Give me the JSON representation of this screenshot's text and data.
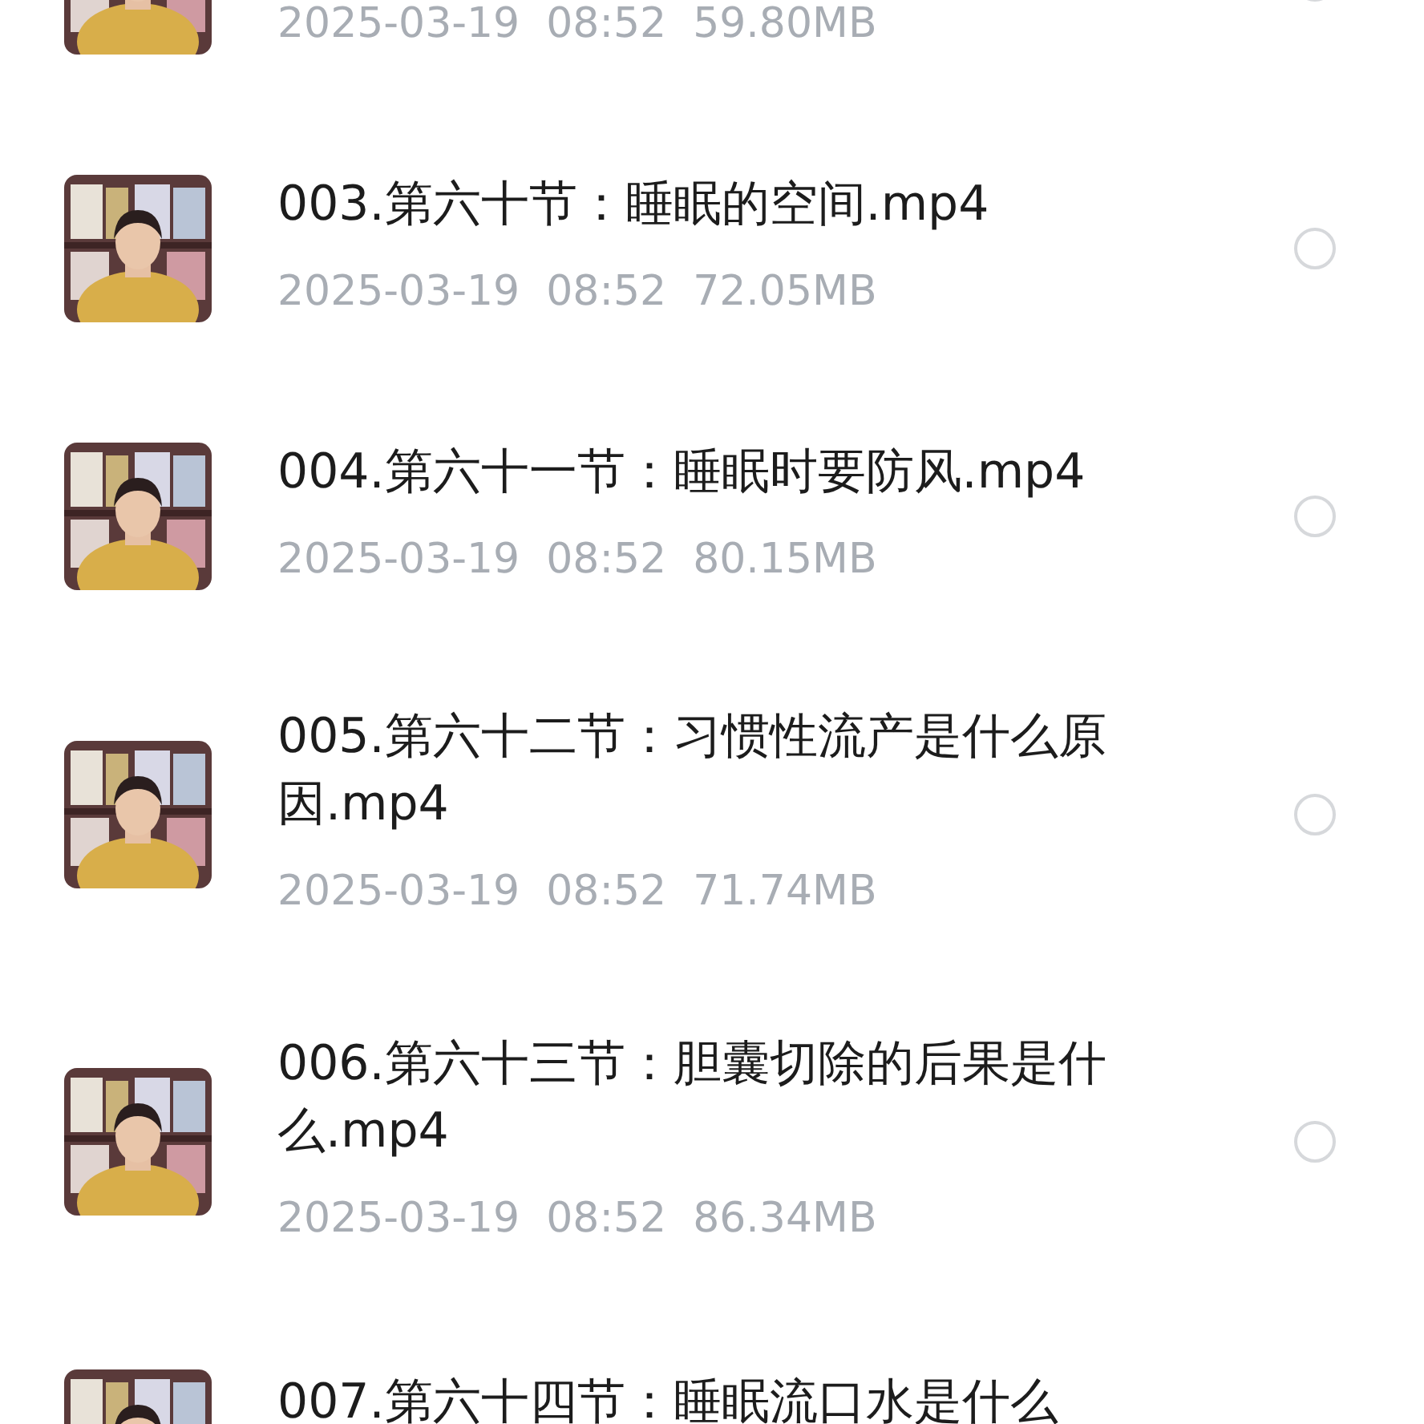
{
  "files": [
    {
      "meta": "2025-03-19  08:52  59.80MB",
      "selected": false
    },
    {
      "title": "003.第六十节：睡眠的空间.mp4",
      "meta": "2025-03-19  08:52  72.05MB",
      "selected": false
    },
    {
      "title": "004.第六十一节：睡眠时要防风.mp4",
      "meta": "2025-03-19  08:52  80.15MB",
      "selected": false
    },
    {
      "title": "005.第六十二节：习惯性流产是什么原因.mp4",
      "meta": "2025-03-19  08:52  71.74MB",
      "selected": false
    },
    {
      "title": "006.第六十三节：胆囊切除的后果是什么.mp4",
      "meta": "2025-03-19  08:52  86.34MB",
      "selected": false
    },
    {
      "title": "007.第六十四节：睡眠流口水是什么"
    }
  ]
}
